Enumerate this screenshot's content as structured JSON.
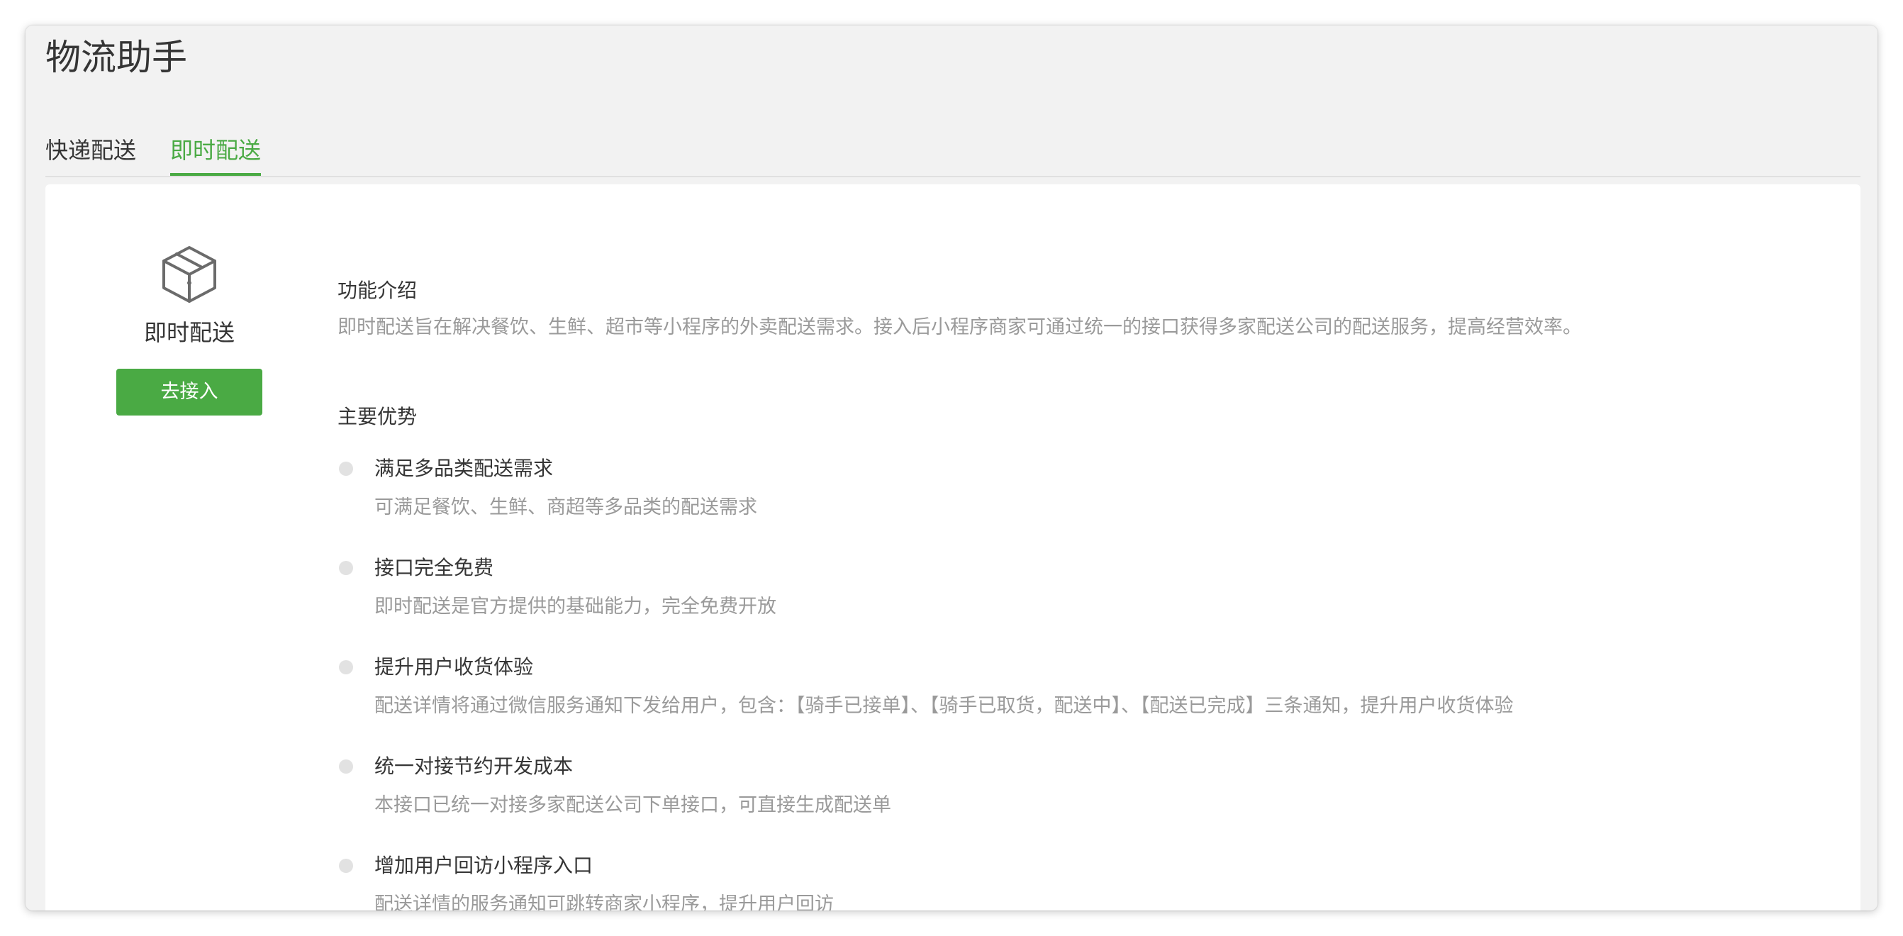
{
  "app": {
    "title": "物流助手"
  },
  "tabs": [
    {
      "label": "快递配送",
      "active": false
    },
    {
      "label": "即时配送",
      "active": true
    }
  ],
  "product": {
    "name": "即时配送",
    "icon": "package-box-icon",
    "button_label": "去接入"
  },
  "intro": {
    "title": "功能介绍",
    "description": "即时配送旨在解决餐饮、生鲜、超市等小程序的外卖配送需求。接入后小程序商家可通过统一的接口获得多家配送公司的配送服务，提高经营效率。"
  },
  "advantages": {
    "title": "主要优势",
    "items": [
      {
        "title": "满足多品类配送需求",
        "desc": "可满足餐饮、生鲜、商超等多品类的配送需求"
      },
      {
        "title": "接口完全免费",
        "desc": "即时配送是官方提供的基础能力，完全免费开放"
      },
      {
        "title": "提升用户收货体验",
        "desc": "配送详情将通过微信服务通知下发给用户，包含：【骑手已接单】、【骑手已取货，配送中】、【配送已完成】三条通知，提升用户收货体验"
      },
      {
        "title": "统一对接节约开发成本",
        "desc": "本接口已统一对接多家配送公司下单接口，可直接生成配送单"
      },
      {
        "title": "增加用户回访小程序入口",
        "desc": "配送详情的服务通知可跳转商家小程序，提升用户回访"
      }
    ]
  },
  "colors": {
    "accent": "#4aaa44",
    "text": "#353535",
    "muted": "#9a9a9a"
  }
}
